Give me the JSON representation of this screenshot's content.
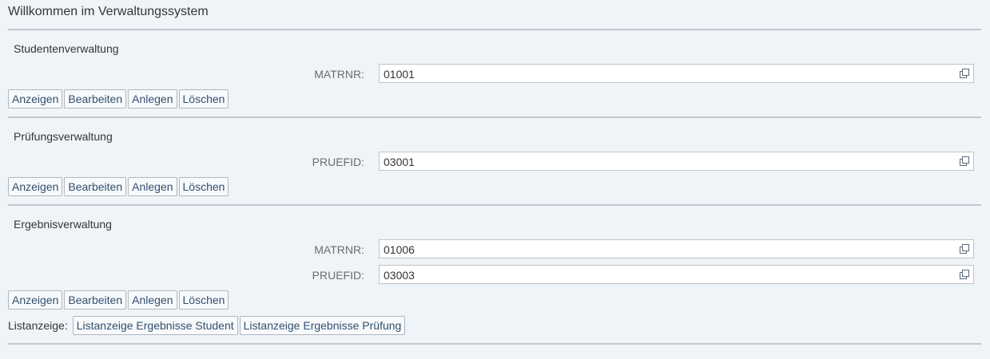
{
  "page": {
    "title": "Willkommen im Verwaltungssystem"
  },
  "sections": {
    "students": {
      "title": "Studentenverwaltung",
      "fields": [
        {
          "label": "MATRNR:",
          "value": "01001"
        }
      ]
    },
    "exams": {
      "title": "Prüfungsverwaltung",
      "fields": [
        {
          "label": "PRUEFID:",
          "value": "03001"
        }
      ]
    },
    "results": {
      "title": "Ergebnisverwaltung",
      "fields": [
        {
          "label": "MATRNR:",
          "value": "01006"
        },
        {
          "label": "PRUEFID:",
          "value": "03003"
        }
      ]
    }
  },
  "actions": {
    "display": "Anzeigen",
    "edit": "Bearbeiten",
    "create": "Anlegen",
    "delete": "Löschen"
  },
  "list": {
    "label": "Listanzeige:",
    "by_student": "Listanzeige Ergebnisse Student",
    "by_exam": "Listanzeige Ergebnisse Prüfung"
  },
  "icons": {
    "value_help": "value-help-icon"
  }
}
